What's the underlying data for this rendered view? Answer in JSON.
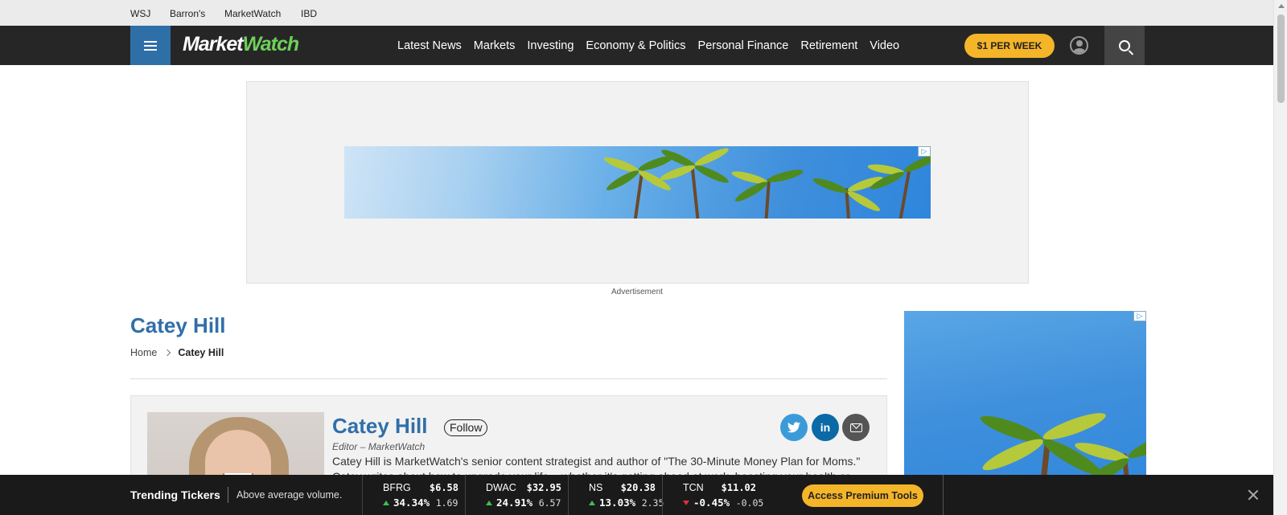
{
  "top_links": [
    "WSJ",
    "Barron's",
    "MarketWatch",
    "IBD"
  ],
  "logo": {
    "part1": "Market",
    "part2": "Watch"
  },
  "nav_links": [
    "Latest News",
    "Markets",
    "Investing",
    "Economy & Politics",
    "Personal Finance",
    "Retirement",
    "Video"
  ],
  "subscribe_label": "$1 PER WEEK",
  "ad": {
    "choices_glyph": "▷",
    "label": "Advertisement"
  },
  "page": {
    "title": "Catey Hill",
    "breadcrumb": {
      "home": "Home",
      "current": "Catey Hill"
    }
  },
  "author": {
    "name": "Catey Hill",
    "follow_label": "Follow",
    "role": "Editor – MarketWatch",
    "bio": "Catey Hill is MarketWatch's senior content strategist and author of \"The 30-Minute Money Plan for Moms.\" Catey writes about how to upgrade your life – whether it's getting ahead at work, boosting your health or",
    "social": {
      "twitter": "t",
      "linkedin": "in"
    }
  },
  "trending": {
    "title": "Trending Tickers",
    "subtitle": "Above average volume.",
    "tickers": [
      {
        "symbol": "BFRG",
        "price": "$6.58",
        "pct": "34.34%",
        "abs": "1.69",
        "direction": "up"
      },
      {
        "symbol": "DWAC",
        "price": "$32.95",
        "pct": "24.91%",
        "abs": "6.57",
        "direction": "up"
      },
      {
        "symbol": "NS",
        "price": "$20.38",
        "pct": "13.03%",
        "abs": "2.35",
        "direction": "up"
      },
      {
        "symbol": "TCN",
        "price": "$11.02",
        "pct": "-0.45%",
        "abs": "-0.05",
        "direction": "down"
      }
    ],
    "premium_label": "Access Premium Tools"
  },
  "colors": {
    "brand_blue": "#2f6fa8",
    "accent_yellow": "#f5b529",
    "logo_green": "#6ed05a",
    "nav_bg": "#262626",
    "up_green": "#3fbf4f",
    "down_red": "#e0303a"
  }
}
